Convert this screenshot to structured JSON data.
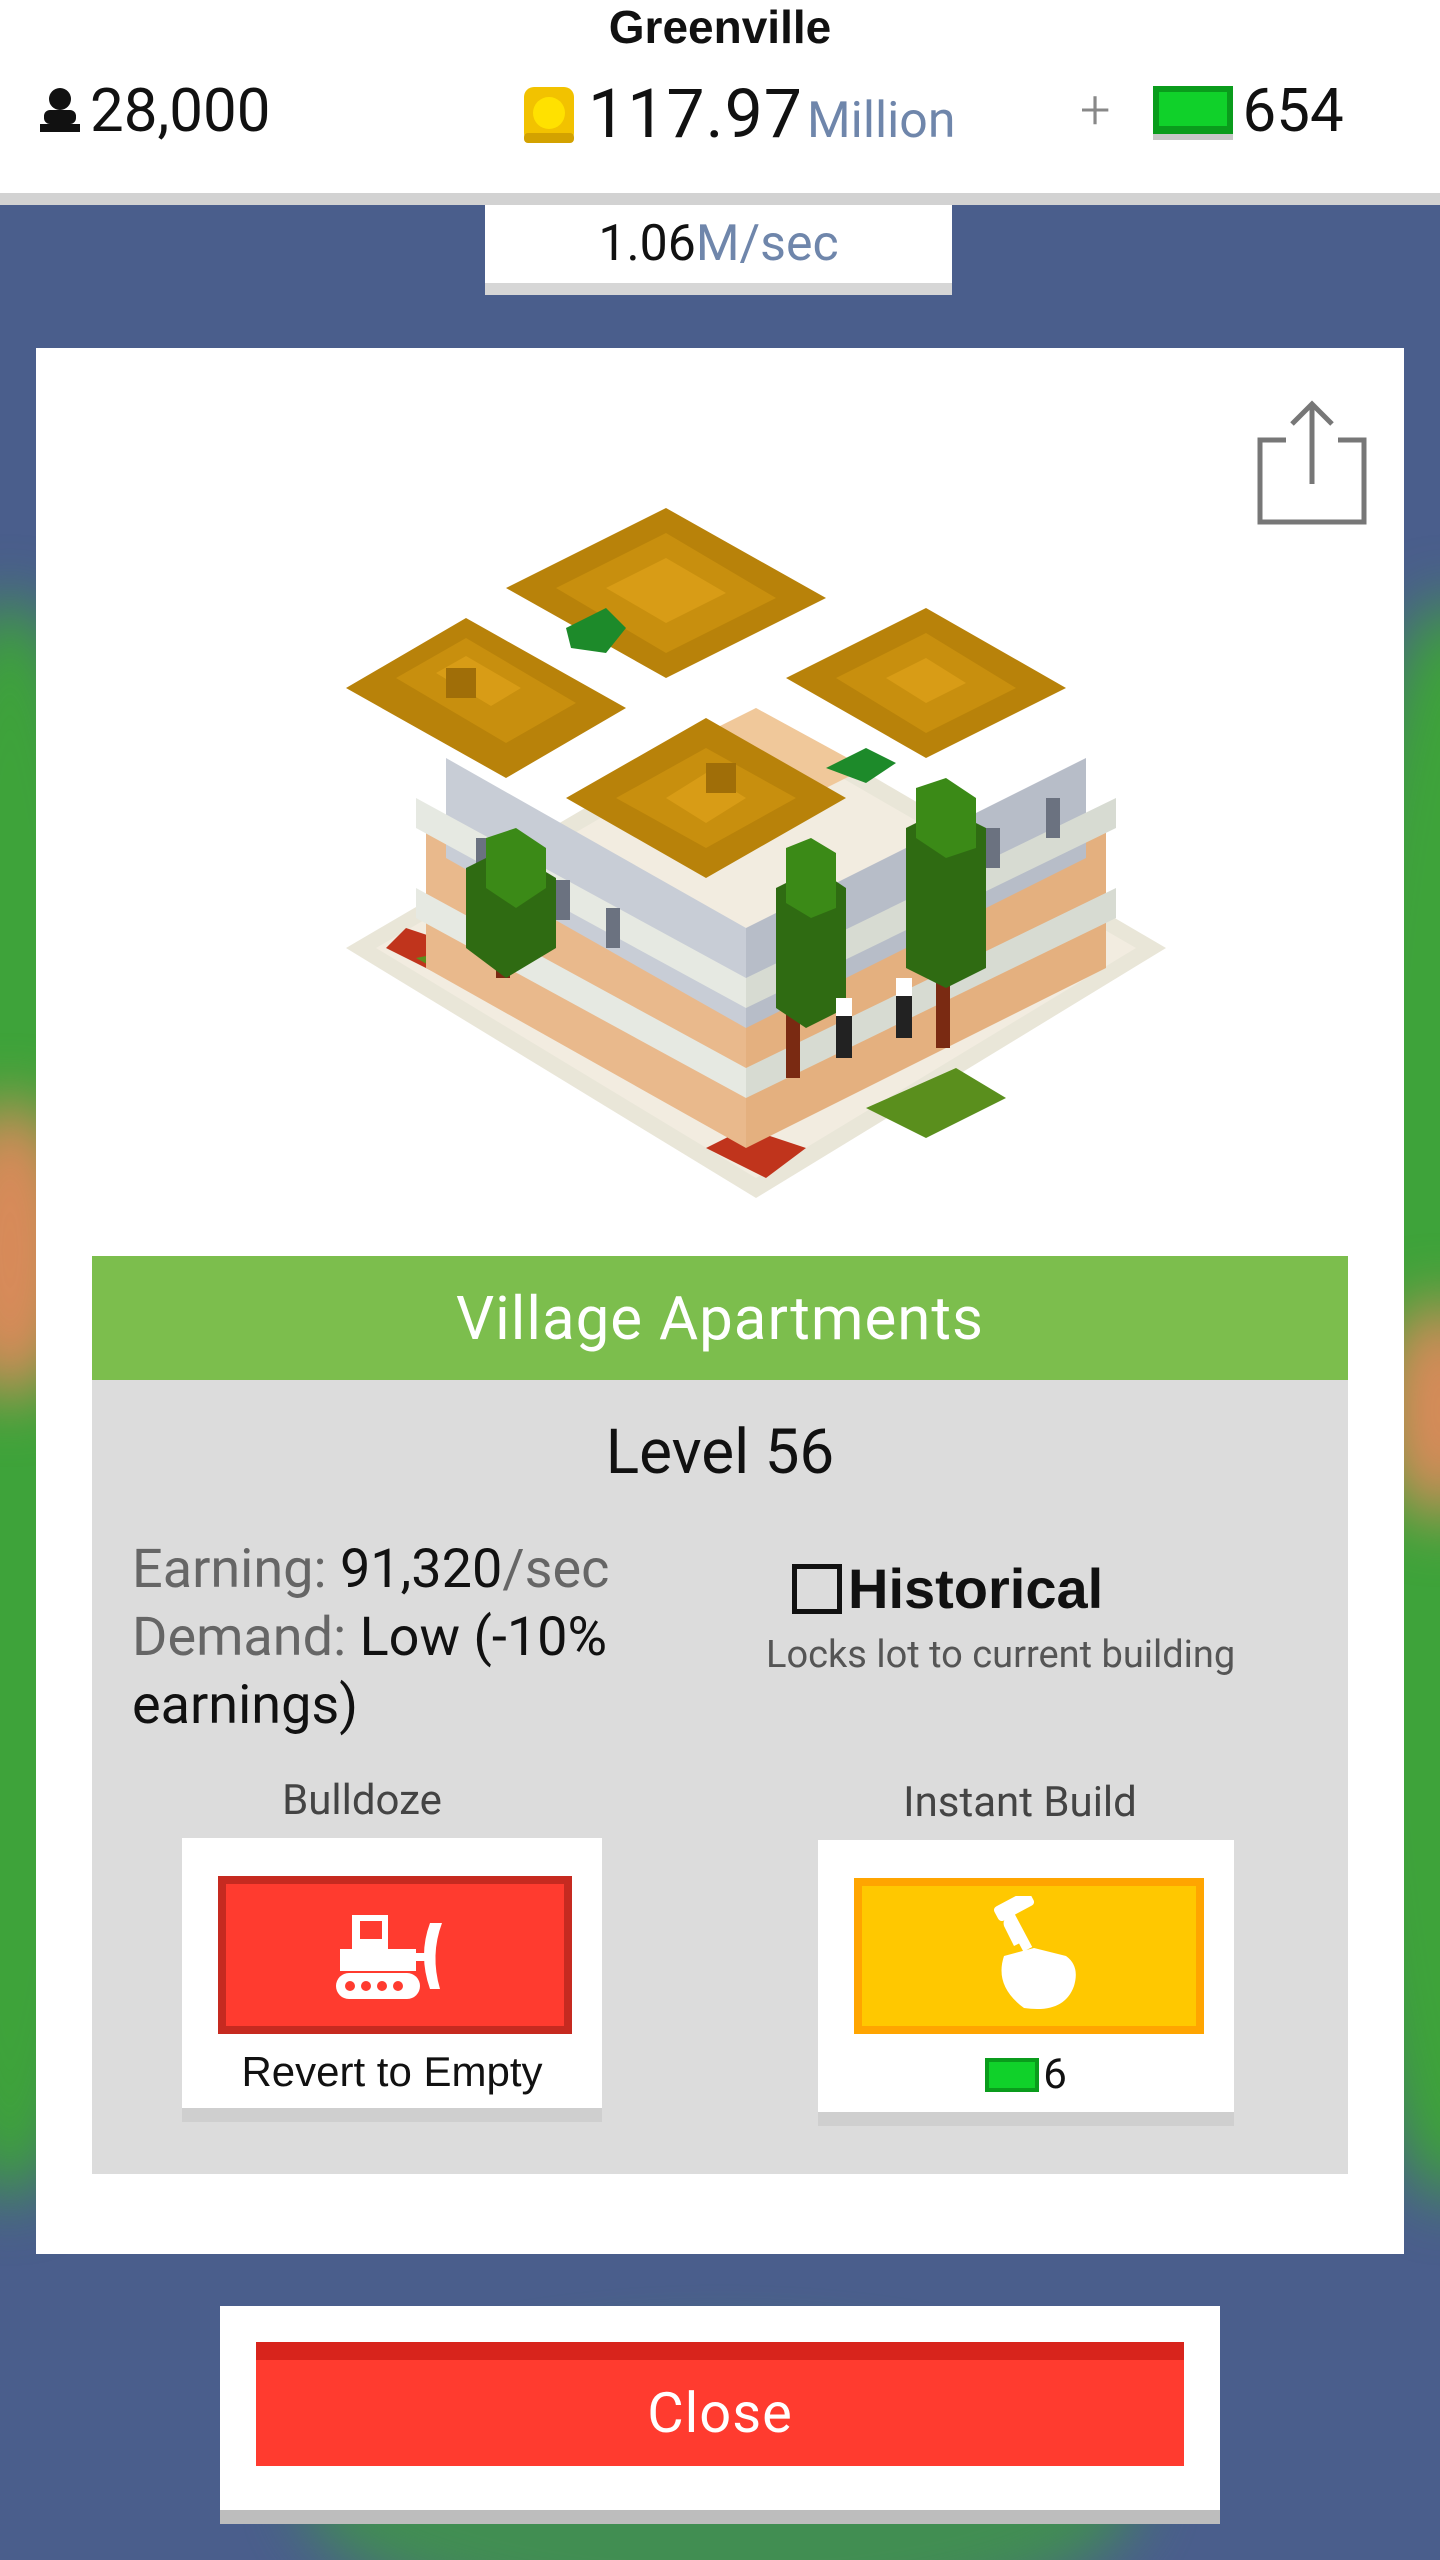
{
  "hud": {
    "city_name": "Greenville",
    "population": "28,000",
    "coins_amount": "117.97",
    "coins_unit": "Million",
    "plus_label": "+",
    "bucks": "654",
    "rate_value": "1.06",
    "rate_unit": "M/sec"
  },
  "building": {
    "name": "Village Apartments",
    "level": "Level 56",
    "earning_label": "Earning:",
    "earning_value": "91,320",
    "earning_unit": "/sec",
    "demand_label": "Demand:",
    "demand_value": "Low (-10% earnings)"
  },
  "historical": {
    "label": "Historical",
    "checked": false,
    "description": "Locks lot to current building"
  },
  "bulldoze": {
    "label": "Bulldoze",
    "button_text": "Revert to Empty"
  },
  "instant_build": {
    "label": "Instant Build",
    "cost": "6"
  },
  "close_label": "Close",
  "colors": {
    "header_green": "#7cbe4d",
    "bulldoze_red": "#ff3b2f",
    "instant_yellow": "#ffc800",
    "bucks_green": "#10d12a",
    "background_blue": "#4a5e8c"
  }
}
